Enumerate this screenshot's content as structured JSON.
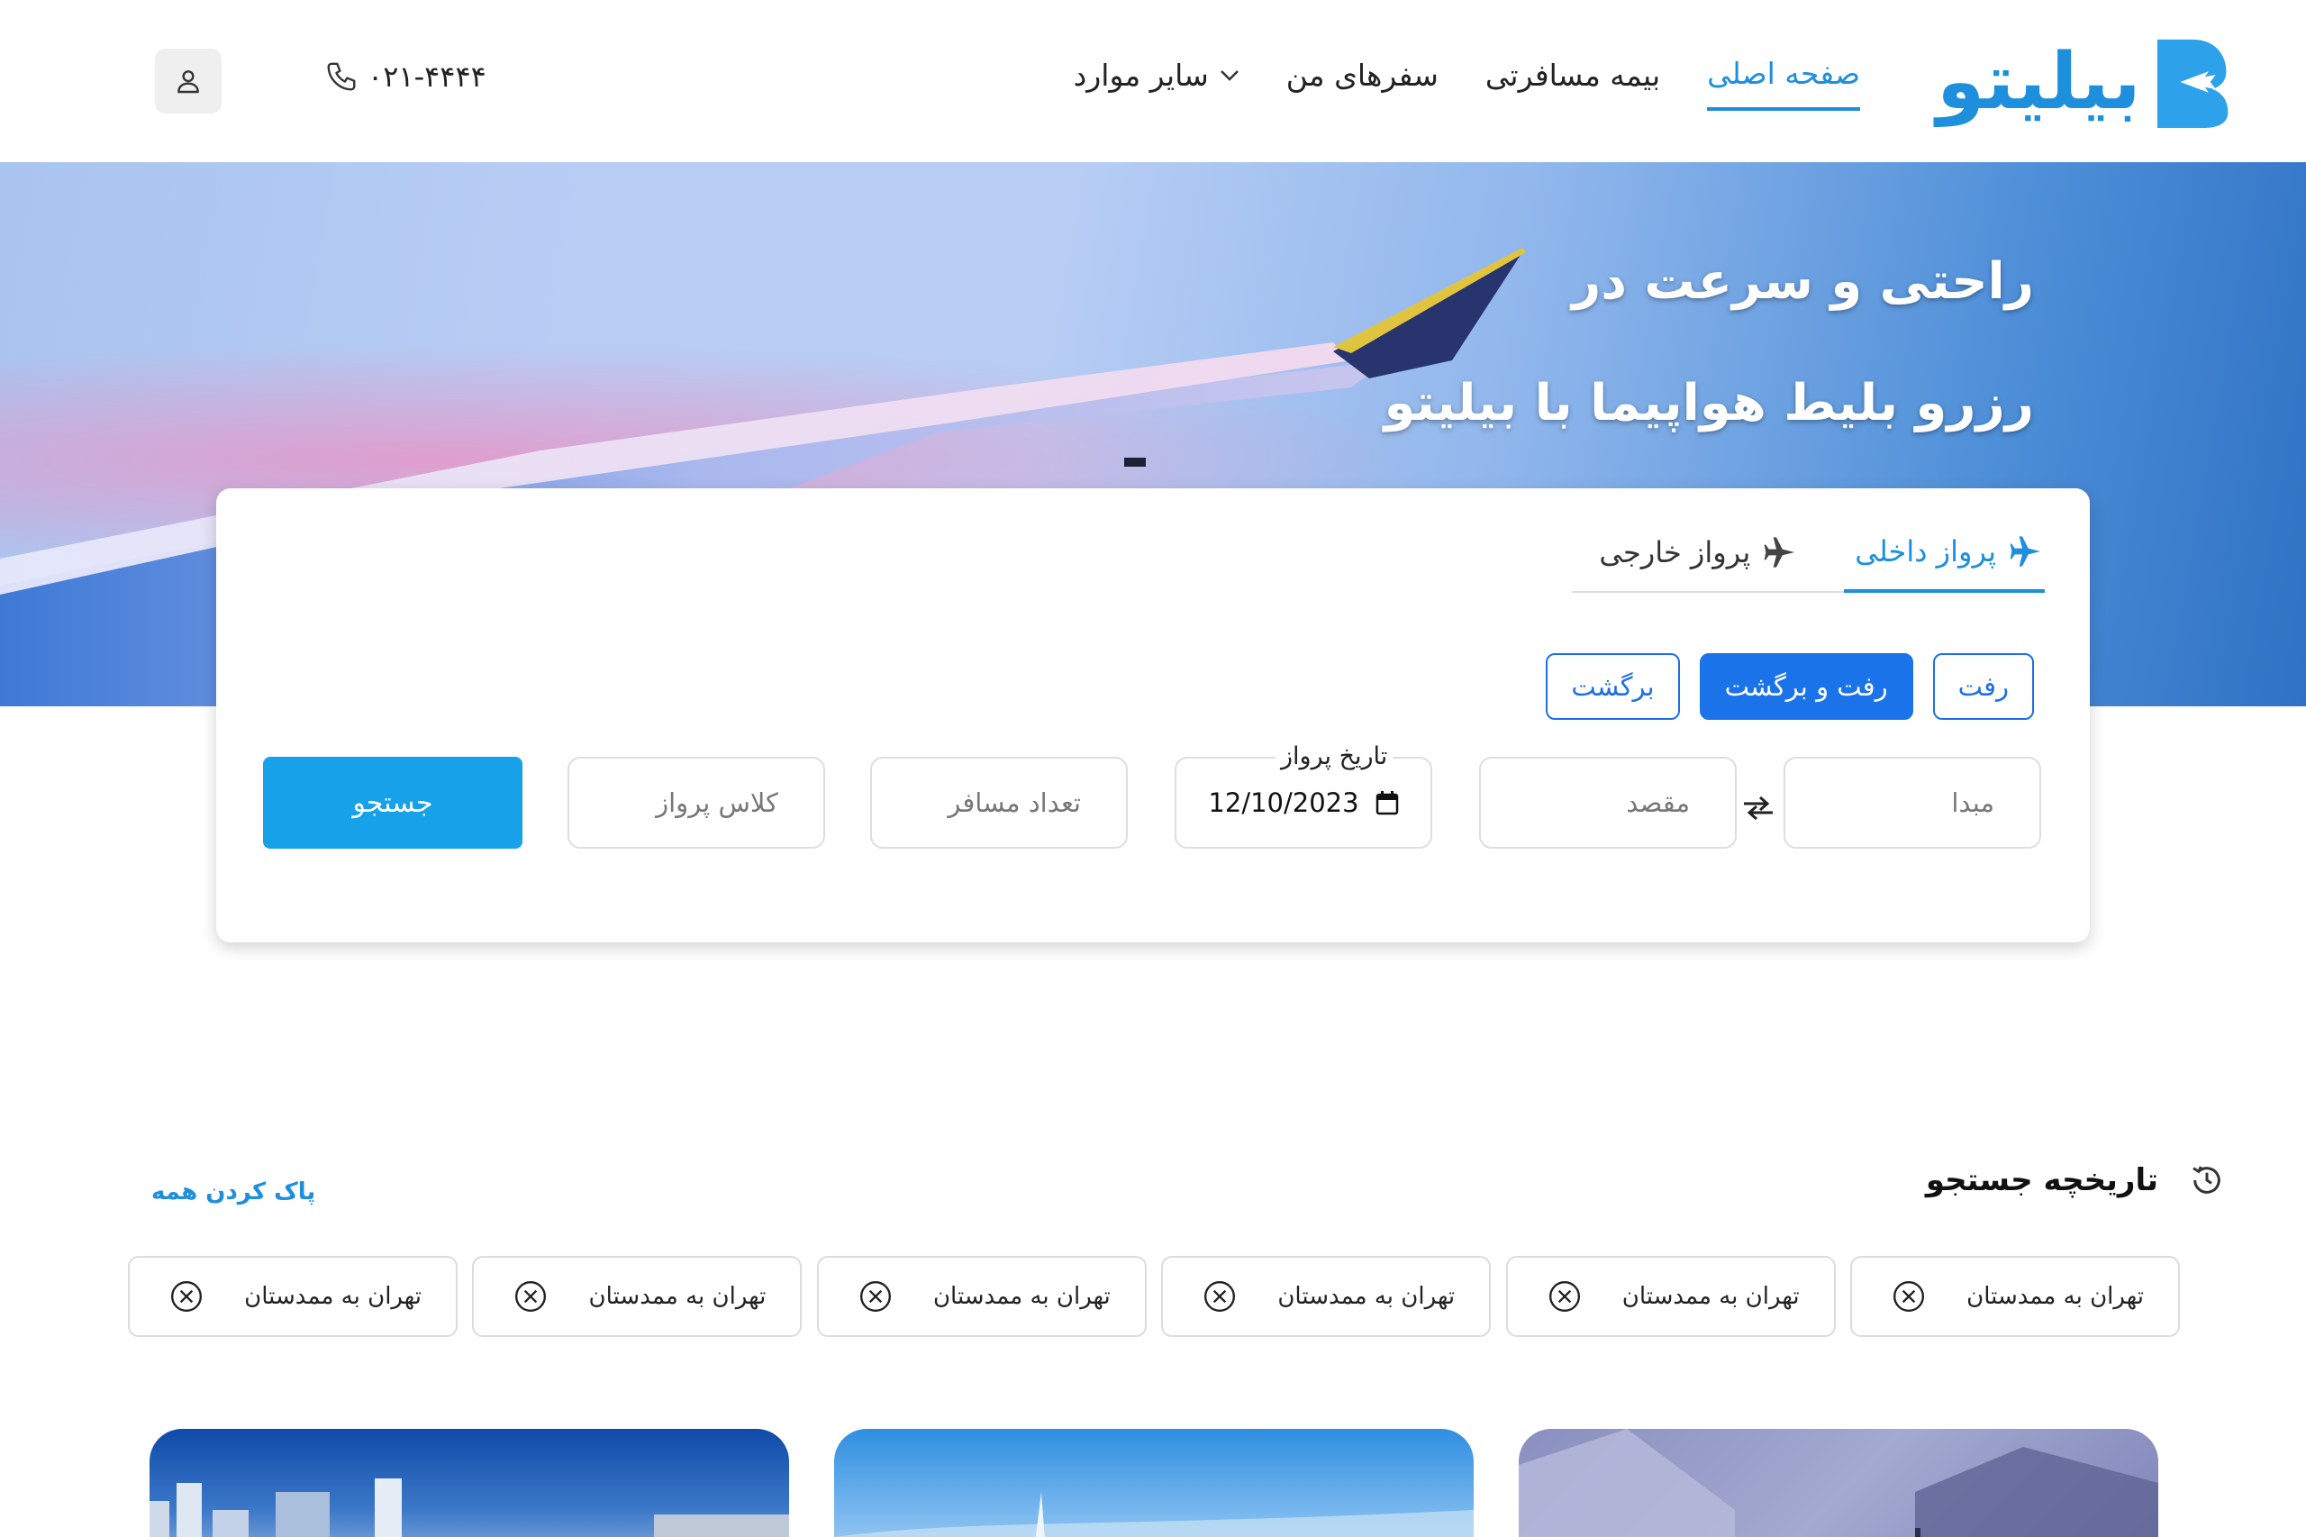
{
  "header": {
    "logo_text": "بیلیتو",
    "nav": [
      {
        "label": "صفحه اصلی",
        "active": true
      },
      {
        "label": "بیمه مسافرتی",
        "active": false
      },
      {
        "label": "سفرهای من",
        "active": false
      },
      {
        "label": "سایر موارد",
        "active": false
      }
    ],
    "phone": "۰۲۱-۴۴۴۴"
  },
  "hero": {
    "line1": "راحتی و سرعت در",
    "line2": "رزرو بلیط هواپیما  با بیلیتو"
  },
  "search": {
    "tabs": [
      {
        "label": "پرواز داخلی",
        "active": true
      },
      {
        "label": "پرواز خارجی",
        "active": false
      }
    ],
    "trip_types": [
      {
        "label": "رفت",
        "active": false
      },
      {
        "label": "رفت و برگشت",
        "active": true
      },
      {
        "label": "برگشت",
        "active": false
      }
    ],
    "origin_placeholder": "مبدا",
    "destination_placeholder": "مقصد",
    "date_label": "تاریخ پرواز",
    "date_value": "12/10/2023",
    "passengers_placeholder": "تعداد مسافر",
    "class_placeholder": "کلاس پرواز",
    "search_label": "جستجو"
  },
  "history": {
    "title": "تاریخچه جستجو",
    "clear_label": "پاک کردن همه",
    "items": [
      "تهران به ممدستان",
      "تهران به ممدستان",
      "تهران به ممدستان",
      "تهران به ممدستان",
      "تهران به ممدستان",
      "تهران به ممدستان"
    ]
  },
  "colors": {
    "brand": "#1d8fdc",
    "primary_button": "#1a73e8",
    "search_button": "#16a1e8"
  }
}
